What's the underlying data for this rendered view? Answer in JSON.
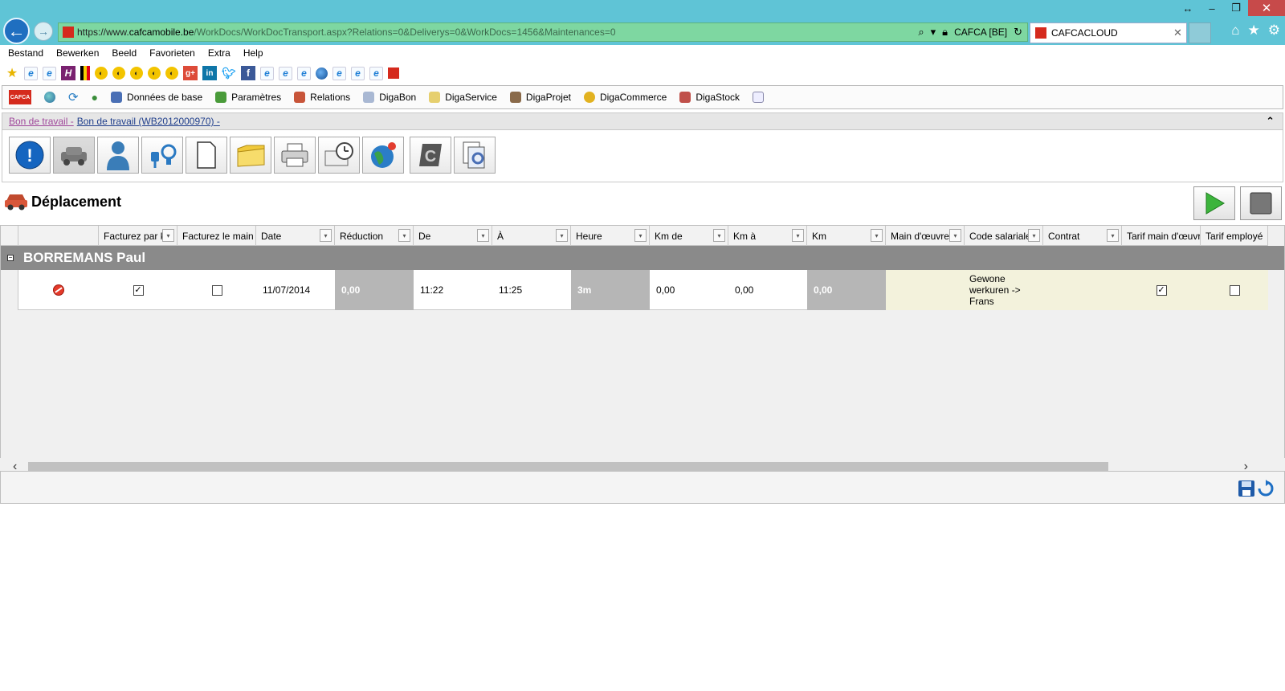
{
  "browser": {
    "url_prefix": "https://www.",
    "url_host": "cafcamobile.be",
    "url_path": "/WorkDocs/WorkDocTransport.aspx?Relations=0&Deliverys=0&WorkDocs=1456&Maintenances=0",
    "cert_label": "CAFCA [BE]",
    "tab_title": "CAFCACLOUD",
    "menu": [
      "Bestand",
      "Bewerken",
      "Beeld",
      "Favorieten",
      "Extra",
      "Help"
    ]
  },
  "app_nav": {
    "items": [
      "Données de base",
      "Paramètres",
      "Relations",
      "DigaBon",
      "DigaService",
      "DigaProjet",
      "DigaCommerce",
      "DigaStock"
    ]
  },
  "breadcrumb": {
    "part1": "Bon de travail -",
    "part2": "Bon de travail (WB2012000970) -"
  },
  "section": {
    "title": "Déplacement"
  },
  "grid": {
    "columns": [
      "",
      "Facturez par km",
      "Facturez le main d",
      "Date",
      "Réduction",
      "De",
      "À",
      "Heure",
      "Km de",
      "Km à",
      "Km",
      "Main d'œuvre",
      "Code salariale",
      "Contrat",
      "Tarif main d'œuvr",
      "Tarif employé"
    ],
    "group": "BORREMANS Paul",
    "row": {
      "facturez_par_km": true,
      "facturez_main": false,
      "date": "11/07/2014",
      "reduction": "0,00",
      "de": "11:22",
      "a": "11:25",
      "heure": "3m",
      "km_de": "0,00",
      "km_a": "0,00",
      "km": "0,00",
      "main_oeuvre": "",
      "code_salariale": "Gewone werkuren -> Frans",
      "contrat": "",
      "tarif_main": true,
      "tarif_employe": false
    }
  }
}
